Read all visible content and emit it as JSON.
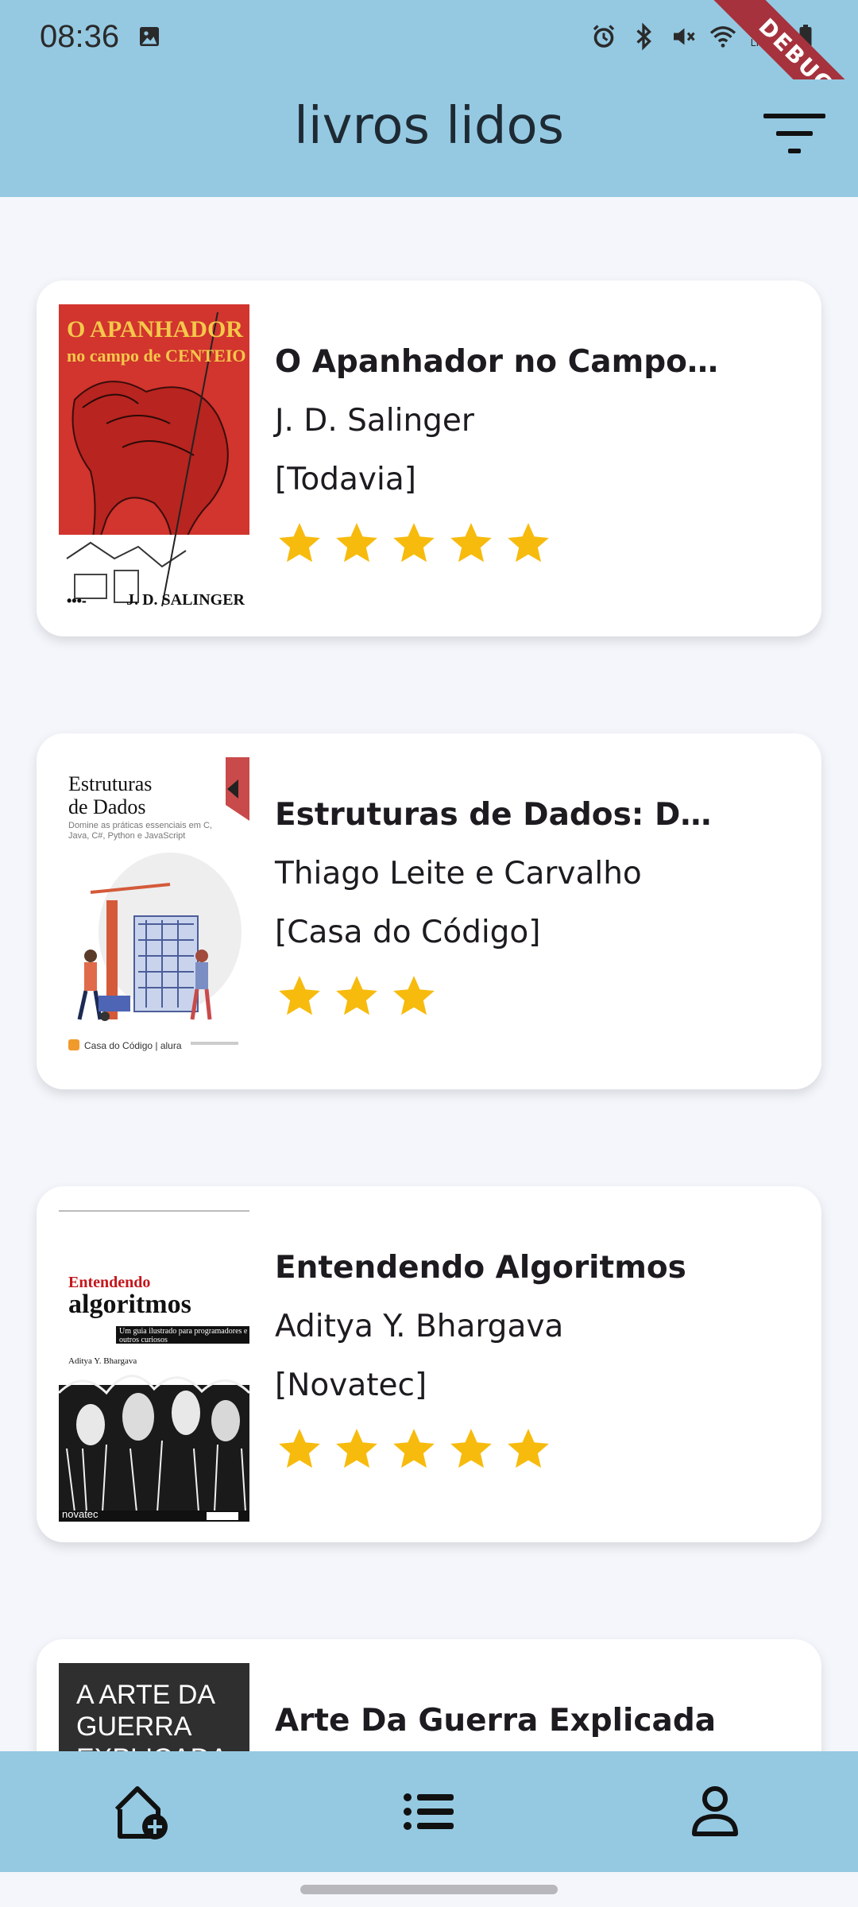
{
  "status_bar": {
    "time": "08:36",
    "icons": [
      "image-icon",
      "alarm-icon",
      "bluetooth-icon",
      "mute-icon",
      "wifi-icon",
      "volte-icon",
      "battery-icon"
    ],
    "volte_label": "Vo) LTE"
  },
  "debug_banner": "DEBUG",
  "app_bar": {
    "title": "livros lidos",
    "filter_icon": "filter-icon",
    "background": "#95c9e2"
  },
  "books": [
    {
      "title": "O Apanhador no Campo d…",
      "author": "J. D. Salinger",
      "publisher": "[Todavia]",
      "rating": 5,
      "cover": {
        "line1": "O APANHADOR",
        "line2": "no campo de CENTEIO",
        "author": "J. D. SALINGER",
        "mark": "•••-",
        "bg": "#d2342e"
      }
    },
    {
      "title": "Estruturas de Dados: Dom…",
      "author": "Thiago Leite e Carvalho",
      "publisher": "[Casa do Código]",
      "rating": 3,
      "cover": {
        "line1": "Estruturas",
        "line2": "de Dados",
        "subtitle": "Domine as práticas essenciais em C, Java, C#, Python e JavaScript",
        "brand": "Casa do Código | alura"
      }
    },
    {
      "title": "Entendendo Algoritmos",
      "author": "Aditya Y. Bhargava",
      "publisher": "[Novatec]",
      "rating": 5,
      "cover": {
        "line1": "Entendendo",
        "line2": "algoritmos",
        "subtitle": "Um guia ilustrado para programadores e outros curiosos",
        "author": "Aditya Y. Bhargava",
        "publisher": "novatec"
      }
    },
    {
      "title": "Arte Da Guerra Explicada",
      "author": "",
      "publisher": "",
      "rating": 0,
      "cover": {
        "line1": "A ARTE DA",
        "line2": "GUERRA",
        "line3": "EXPLICADA"
      }
    }
  ],
  "star_color": "#f7bb0e",
  "bottom_nav": {
    "items": [
      "add-home-icon",
      "list-icon",
      "person-icon"
    ]
  }
}
